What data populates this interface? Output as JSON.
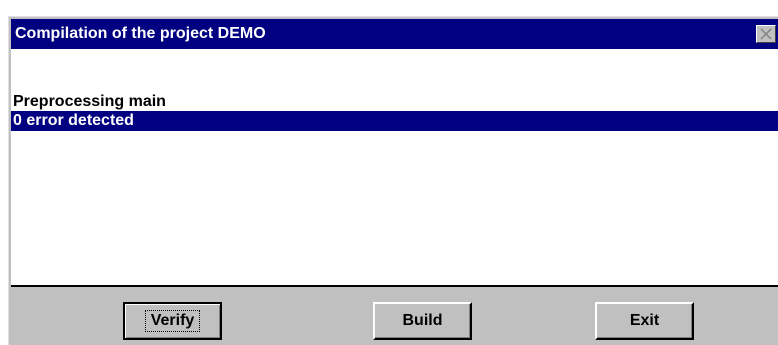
{
  "window": {
    "title": "Compilation of the project DEMO"
  },
  "log": {
    "lines": [
      "Preprocessing main",
      "0 error detected"
    ],
    "selected_index": 1
  },
  "buttons": {
    "verify": {
      "label": "Verify",
      "mnemonic": "V"
    },
    "build": {
      "label": "Build"
    },
    "exit": {
      "label": "Exit"
    }
  },
  "colors": {
    "titlebar": "#000080",
    "selection": "#000080",
    "face": "#c0c0c0"
  },
  "icons": {
    "close": "close-icon"
  }
}
